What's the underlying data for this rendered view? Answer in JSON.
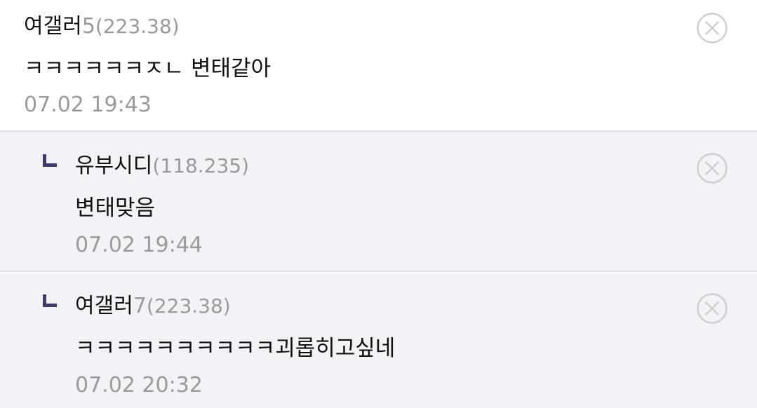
{
  "comments": [
    {
      "author": "여갤러",
      "author_suffix": "5",
      "ip": "(223.38)",
      "text": "ㅋㅋㅋㅋㅋㅋㅈㄴ 변태같아",
      "time": "07.02 19:43"
    },
    {
      "author": "유부시디",
      "author_suffix": "",
      "ip": "(118.235)",
      "text": "변태맞음",
      "time": "07.02 19:44"
    },
    {
      "author": "여갤러",
      "author_suffix": "7",
      "ip": "(223.38)",
      "text": "ㅋㅋㅋㅋㅋㅋㅋㅋㅋㅋ괴롭히고싶네",
      "time": "07.02 20:32"
    }
  ],
  "icons": {
    "delete": "close-circle-icon",
    "reply": "reply-corner-icon"
  },
  "colors": {
    "reply_background": "#f3f3f7",
    "reply_marker": "#3b3b6e",
    "muted_text": "#9a9a9a",
    "divider": "#e0e0e6"
  }
}
